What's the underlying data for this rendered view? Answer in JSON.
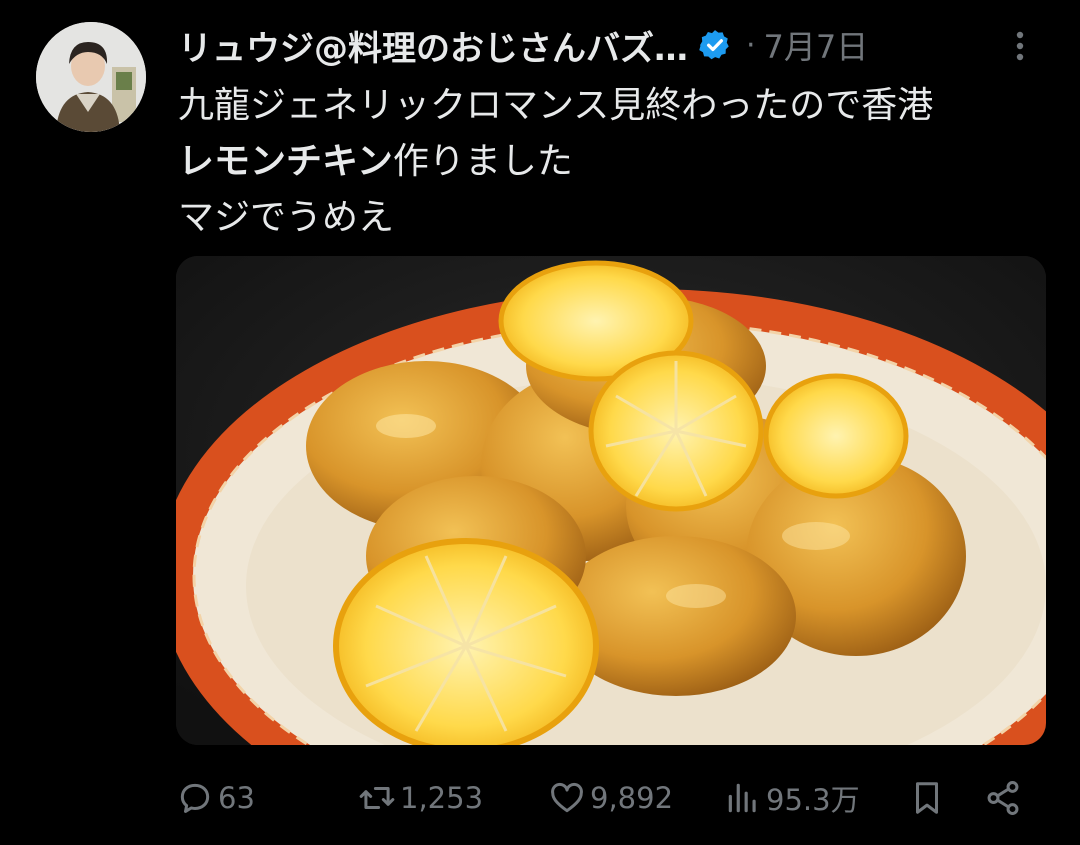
{
  "tweet": {
    "display_name": "リュウジ@料理のおじさんバズ…",
    "separator": "·",
    "date": "7月7日",
    "text_line1": "九龍ジェネリックロマンス見終わったので香港",
    "text_line2_bold": "レモンチキン",
    "text_line2_rest": "作りました",
    "text_line3": "マジでうめえ"
  },
  "stats": {
    "replies": "63",
    "retweets": "1,253",
    "likes": "9,892",
    "views": "95.3万"
  },
  "icons": {
    "verified": "verified-badge-icon",
    "more": "more-options-icon",
    "reply": "reply-icon",
    "retweet": "retweet-icon",
    "like": "heart-icon",
    "views": "views-icon",
    "bookmark": "bookmark-icon",
    "share": "share-icon"
  },
  "colors": {
    "background": "#000000",
    "text": "#e7e9ea",
    "muted": "#71767b",
    "verified": "#1d9bf0"
  }
}
